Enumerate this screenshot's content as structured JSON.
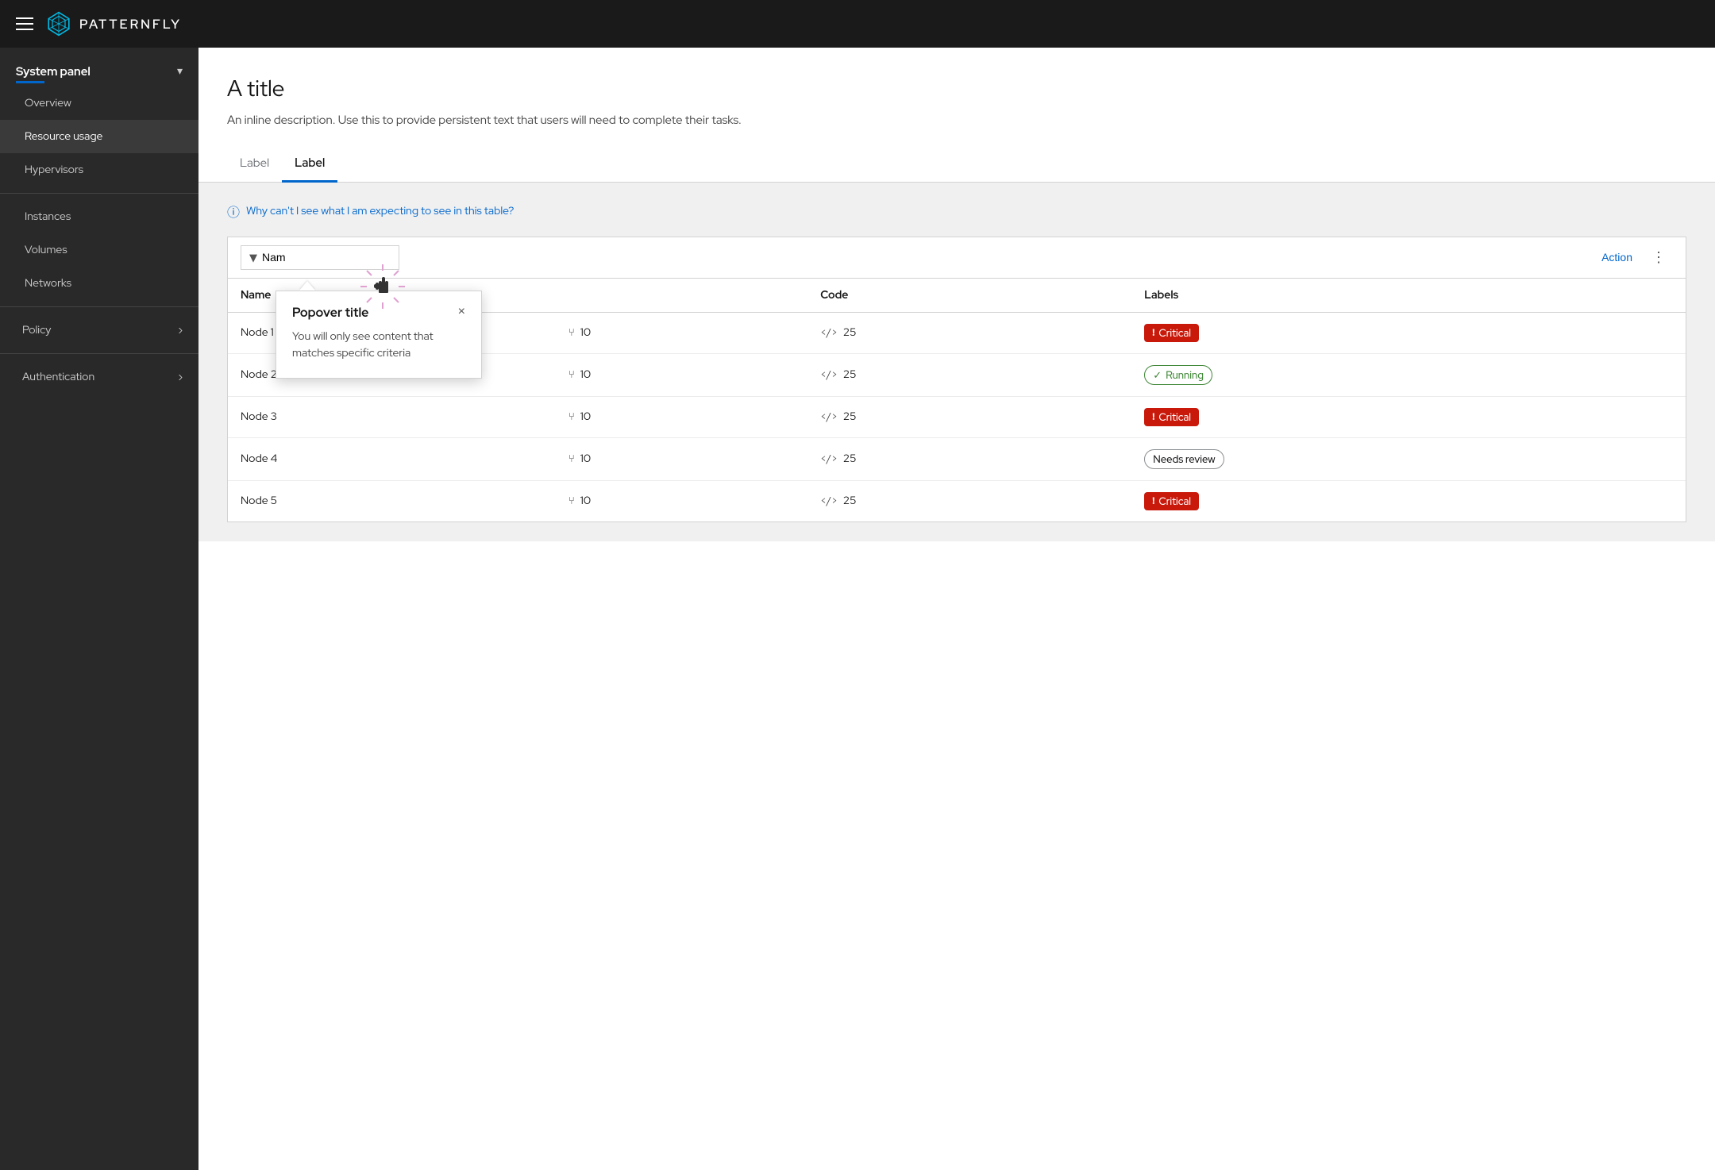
{
  "topnav": {
    "logo_text": "PATTERNFLY"
  },
  "sidebar": {
    "group_title": "System panel",
    "items_top": [
      {
        "label": "Overview",
        "id": "overview"
      },
      {
        "label": "Resource usage",
        "id": "resource-usage"
      },
      {
        "label": "Hypervisors",
        "id": "hypervisors"
      }
    ],
    "items_mid": [
      {
        "label": "Instances",
        "id": "instances"
      },
      {
        "label": "Volumes",
        "id": "volumes"
      },
      {
        "label": "Networks",
        "id": "networks"
      }
    ],
    "sections": [
      {
        "label": "Policy",
        "id": "policy",
        "has_arrow": true
      },
      {
        "label": "Authentication",
        "id": "authentication",
        "has_arrow": true
      }
    ]
  },
  "page": {
    "title": "A title",
    "description": "An inline description. Use this to provide persistent text that users will need to complete their tasks."
  },
  "tabs": [
    {
      "label": "Label",
      "id": "tab1",
      "active": false
    },
    {
      "label": "Label",
      "id": "tab2",
      "active": true
    }
  ],
  "info_link": {
    "text": "Why can't I see what I am expecting to see in this table?"
  },
  "toolbar": {
    "filter_placeholder": "Nam",
    "action_label": "Action",
    "kebab": "⋮"
  },
  "popover": {
    "title": "Popover title",
    "body": "You will only see content that matches specific criteria",
    "close_label": "×"
  },
  "table": {
    "columns": [
      {
        "label": "Name",
        "id": "name"
      },
      {
        "label": "",
        "id": "branch"
      },
      {
        "label": "Code",
        "id": "code"
      },
      {
        "label": "Labels",
        "id": "labels"
      }
    ],
    "rows": [
      {
        "name": "Node 1",
        "branch_val": "10",
        "code_val": "25",
        "label_type": "critical",
        "label_text": "Critical"
      },
      {
        "name": "Node 2",
        "branch_val": "10",
        "code_val": "25",
        "label_type": "running",
        "label_text": "Running"
      },
      {
        "name": "Node 3",
        "branch_val": "10",
        "code_val": "25",
        "label_type": "critical",
        "label_text": "Critical"
      },
      {
        "name": "Node 4",
        "branch_val": "10",
        "code_val": "25",
        "label_type": "needs-review",
        "label_text": "Needs review"
      },
      {
        "name": "Node 5",
        "branch_val": "10",
        "code_val": "25",
        "label_type": "critical",
        "label_text": "Critical"
      }
    ]
  },
  "colors": {
    "accent": "#06c",
    "critical": "#c9190b",
    "running": "#3e8635",
    "sidebar_bg": "#292929",
    "topnav_bg": "#1a1a1a"
  }
}
